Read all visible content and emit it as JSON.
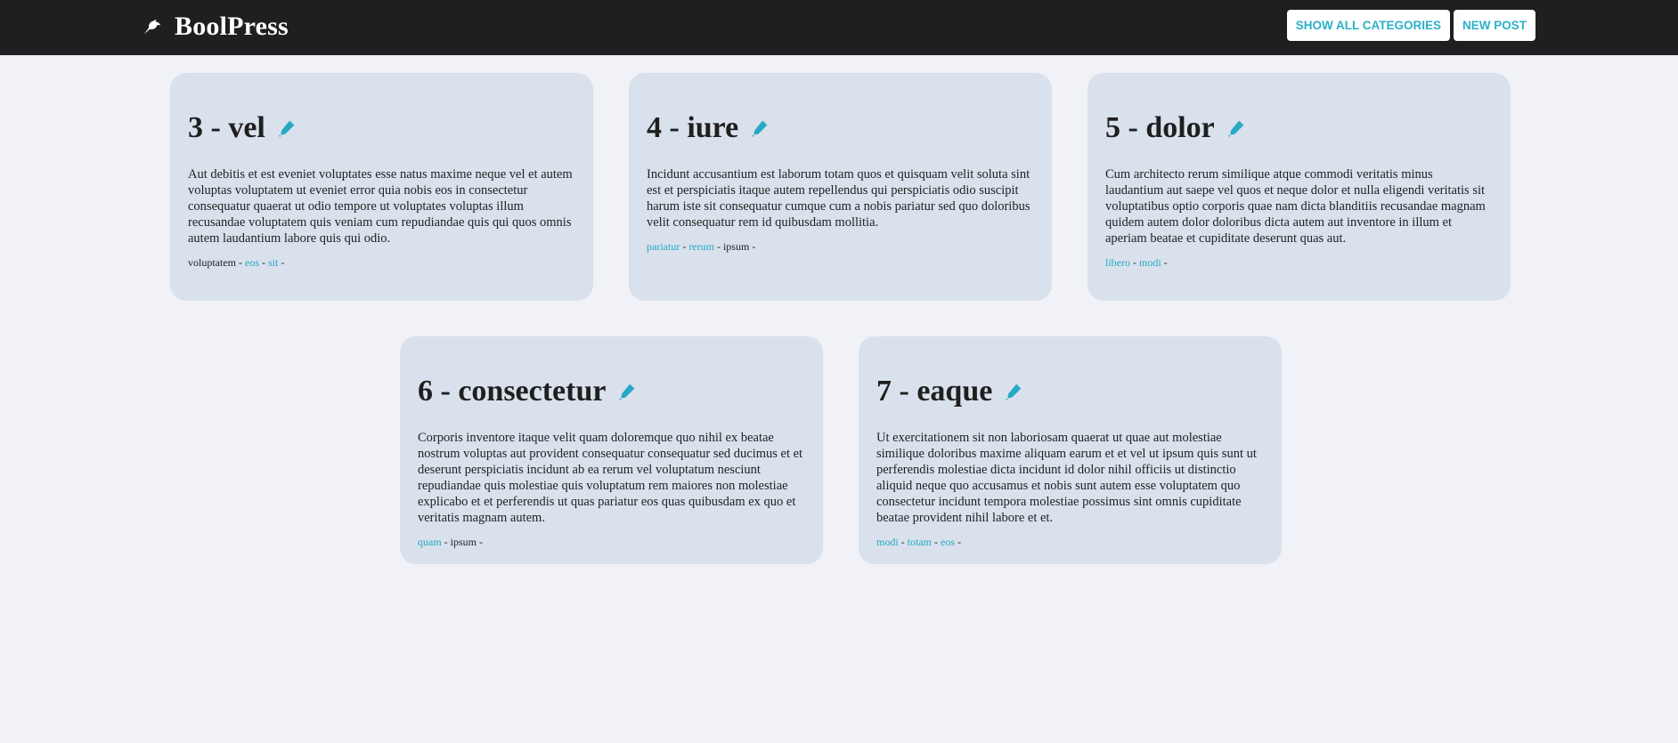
{
  "navbar": {
    "brand": "BoolPress",
    "buttons": {
      "categories": "SHOW ALL CATEGORIES",
      "new_post": "NEW POST"
    }
  },
  "colors": {
    "accent": "#2bb0c9",
    "navbar": "#1f1f22",
    "card": "#d9e1ec",
    "page": "#f0f2f7"
  },
  "icons": {
    "brand": "bird-icon",
    "edit": "pen-icon"
  },
  "posts": [
    {
      "title": "3 - vel",
      "body": "Aut debitis et est eveniet voluptates esse natus maxime neque vel et autem voluptas voluptatem ut eveniet error quia nobis eos in consectetur consequatur quaerat ut odio tempore ut voluptates voluptas illum recusandae voluptatem quis veniam cum repudiandae quis qui quos omnis autem laudantium labore quis qui odio.",
      "tags": [
        {
          "label": "voluptatem",
          "link": false
        },
        {
          "label": "eos",
          "link": true
        },
        {
          "label": "sit",
          "link": true
        }
      ]
    },
    {
      "title": "4 - iure",
      "body": "Incidunt accusantium est laborum totam quos et quisquam velit soluta sint est et perspiciatis itaque autem repellendus qui perspiciatis odio suscipit harum iste sit consequatur cumque cum a nobis pariatur sed quo doloribus velit consequatur rem id quibusdam mollitia.",
      "tags": [
        {
          "label": "pariatur",
          "link": true
        },
        {
          "label": "rerum",
          "link": true
        },
        {
          "label": "ipsum",
          "link": false
        }
      ]
    },
    {
      "title": "5 - dolor",
      "body": "Cum architecto rerum similique atque commodi veritatis minus laudantium aut saepe vel quos et neque dolor et nulla eligendi veritatis sit voluptatibus optio corporis quae nam dicta blanditiis recusandae magnam quidem autem dolor doloribus dicta autem aut inventore in illum et aperiam beatae et cupiditate deserunt quas aut.",
      "tags": [
        {
          "label": "libero",
          "link": true
        },
        {
          "label": "modi",
          "link": true
        }
      ]
    },
    {
      "title": "6 - consectetur",
      "body": "Corporis inventore itaque velit quam doloremque quo nihil ex beatae nostrum voluptas aut provident consequatur consequatur sed ducimus et et deserunt perspiciatis incidunt ab ea rerum vel voluptatum nesciunt repudiandae quis molestiae quis voluptatum rem maiores non molestiae explicabo et et perferendis ut quas pariatur eos quas quibusdam ex quo et veritatis magnam autem.",
      "tags": [
        {
          "label": "quam",
          "link": true
        },
        {
          "label": "ipsum",
          "link": false
        }
      ]
    },
    {
      "title": "7 - eaque",
      "body": "Ut exercitationem sit non laboriosam quaerat ut quae aut molestiae similique doloribus maxime aliquam earum et et vel ut ipsum quis sunt ut perferendis molestiae dicta incidunt id dolor nihil officiis ut distinctio aliquid neque quo accusamus et nobis sunt autem esse voluptatem quo consectetur incidunt tempora molestiae possimus sint omnis cupiditate beatae provident nihil labore et et.",
      "tags": [
        {
          "label": "modi",
          "link": true
        },
        {
          "label": "totam",
          "link": true
        },
        {
          "label": "eos",
          "link": true
        }
      ]
    }
  ]
}
